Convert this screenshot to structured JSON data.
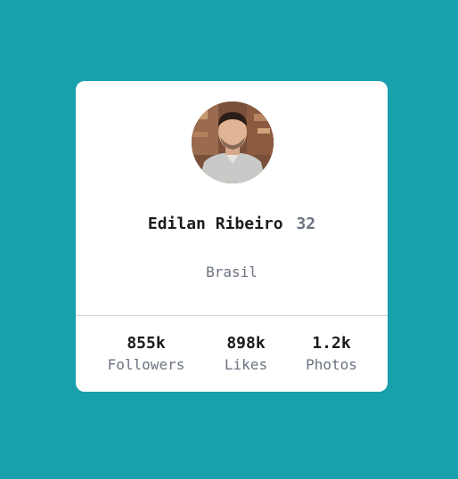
{
  "profile": {
    "name": "Edilan Ribeiro",
    "age": "32",
    "location": "Brasil",
    "avatar": "profile-photo"
  },
  "stats": {
    "followers": {
      "value": "855k",
      "label": "Followers"
    },
    "likes": {
      "value": "898k",
      "label": "Likes"
    },
    "photos": {
      "value": "1.2k",
      "label": "Photos"
    }
  },
  "colors": {
    "background": "#19a0ad",
    "card": "#ffffff",
    "text": "#1b1b1b",
    "muted": "#6b7280",
    "divider": "#d4d4d8"
  }
}
